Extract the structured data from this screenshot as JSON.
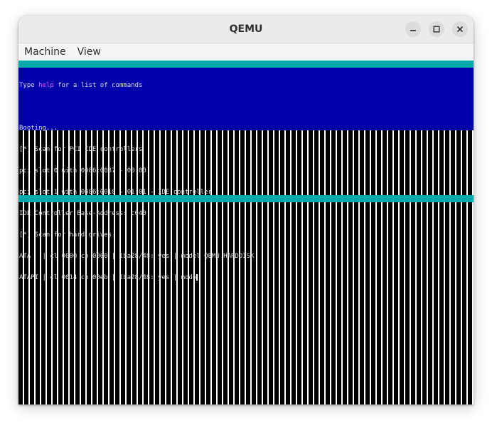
{
  "window": {
    "title": "QEMU"
  },
  "menu": {
    "items": [
      "Machine",
      "View"
    ]
  },
  "console": {
    "intro_prefix": "Type ",
    "intro_keyword": "help",
    "intro_suffix": " for a list of commands",
    "lines": [
      "",
      "Booting...",
      "[*] Scan for PCI IDE controllers",
      "pci slot 0 with 0086:0037 - 00:00",
      "pci slot 1 with 0086:0010 - 01:01 - IDE controller",
      "IDE Controller Base-Address: c040",
      "[*] Scan for hard drives",
      "ATA   | cl 0000 ch 0000 | lba28/48: yes | model QEMU HARDDISK",
      "ATAPI | cl 0014 ch 00eb | lba28/48: yes | mode"
    ]
  },
  "colors": {
    "cyan": "#00aaaa",
    "blue": "#0000aa",
    "highlight": "#ff55ff"
  },
  "icons": {
    "minimize": "minimize-icon",
    "maximize": "maximize-icon",
    "close": "close-icon"
  }
}
